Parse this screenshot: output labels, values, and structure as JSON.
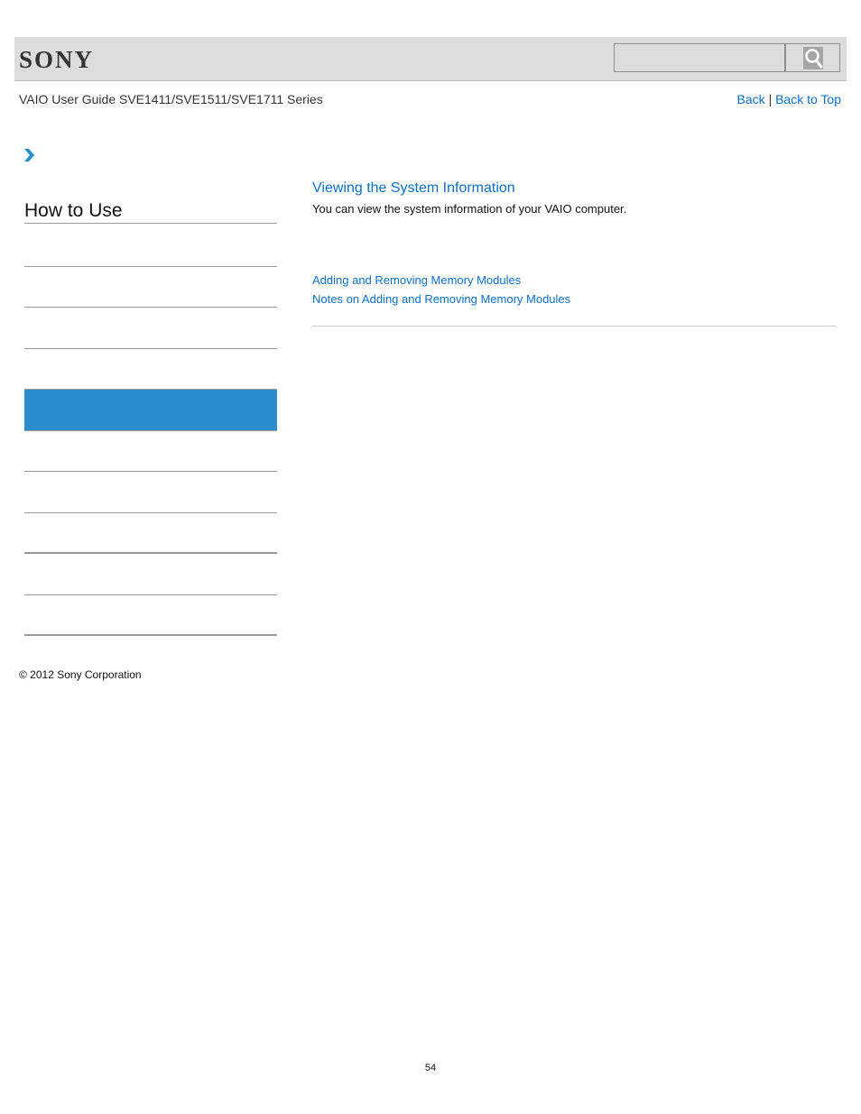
{
  "header": {
    "logo": "SONY",
    "search": {
      "placeholder": "",
      "value": ""
    },
    "search_icon": "search-icon"
  },
  "subheader": {
    "guide_title": "VAIO User Guide SVE1411/SVE1511/SVE1711 Series",
    "back_label": "Back",
    "separator": "|",
    "back_to_top_label": "Back to Top"
  },
  "sidebar": {
    "breadcrumb_icon": "chevron-right-icon",
    "heading": "How to Use",
    "items": [
      {
        "label": "",
        "active": false
      },
      {
        "label": "",
        "active": false
      },
      {
        "label": "",
        "active": false
      },
      {
        "label": "",
        "active": true
      },
      {
        "label": "",
        "active": false
      },
      {
        "label": "",
        "active": false
      },
      {
        "label": "",
        "active": false
      },
      {
        "label": "",
        "active": false
      },
      {
        "label": "",
        "active": false
      }
    ]
  },
  "main": {
    "title": "Viewing the System Information",
    "description": "You can view the system information of your VAIO computer.",
    "related_links": [
      "Adding and Removing Memory Modules",
      "Notes on Adding and Removing Memory Modules"
    ]
  },
  "footer": {
    "copyright": "© 2012 Sony Corporation",
    "page_number": "54"
  },
  "colors": {
    "link": "#0a70c8",
    "active_item": "#2a8ecd",
    "header_bg": "#dcdcdc"
  }
}
